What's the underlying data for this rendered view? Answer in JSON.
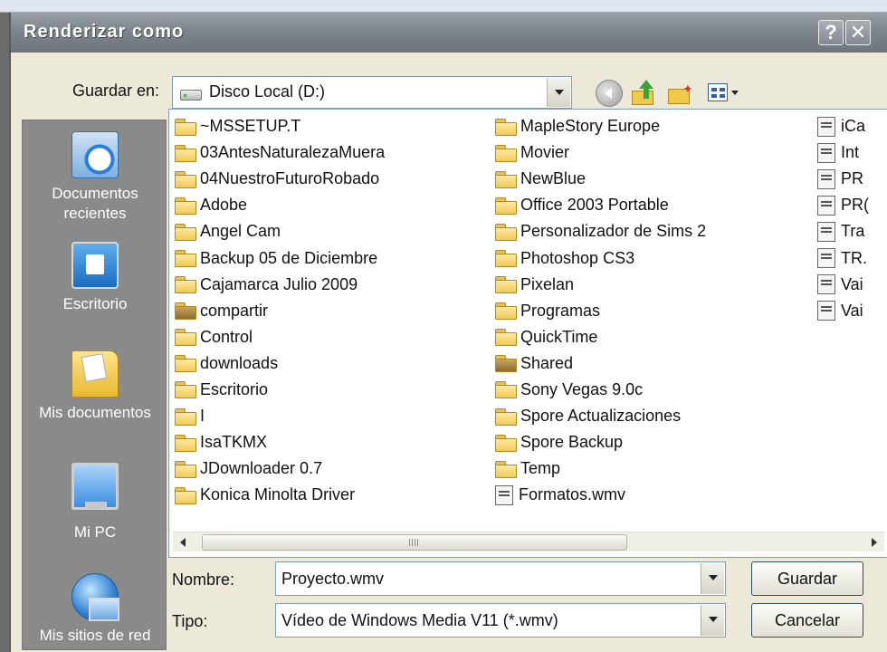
{
  "dialog": {
    "title": "Renderizar como"
  },
  "title_buttons": {
    "help": "?",
    "close": "✕"
  },
  "save_in": {
    "label": "Guardar en:",
    "value": "Disco Local (D:)"
  },
  "toolbar_icons": [
    "back-icon",
    "up-folder-icon",
    "new-folder-icon",
    "views-menu-icon"
  ],
  "places": [
    {
      "label": "Documentos recientes",
      "icon": "recent-documents-icon"
    },
    {
      "label": "Escritorio",
      "icon": "desktop-icon"
    },
    {
      "label": "Mis documentos",
      "icon": "my-documents-icon"
    },
    {
      "label": "Mi PC",
      "icon": "my-computer-icon"
    },
    {
      "label": "Mis sitios de red",
      "icon": "network-places-icon"
    }
  ],
  "files": {
    "column1": [
      {
        "name": "~MSSETUP.T",
        "type": "folder"
      },
      {
        "name": "03AntesNaturalezaMuera",
        "type": "folder"
      },
      {
        "name": "04NuestroFuturoRobado",
        "type": "folder"
      },
      {
        "name": "Adobe",
        "type": "folder"
      },
      {
        "name": "Angel Cam",
        "type": "folder"
      },
      {
        "name": "Backup 05 de Diciembre",
        "type": "folder"
      },
      {
        "name": "Cajamarca Julio 2009",
        "type": "folder"
      },
      {
        "name": "compartir",
        "type": "shared-folder"
      },
      {
        "name": "Control",
        "type": "folder"
      },
      {
        "name": "downloads",
        "type": "folder"
      },
      {
        "name": "Escritorio",
        "type": "folder"
      },
      {
        "name": "I",
        "type": "folder"
      },
      {
        "name": "IsaTKMX",
        "type": "folder"
      },
      {
        "name": "JDownloader 0.7",
        "type": "folder"
      },
      {
        "name": "Konica Minolta Driver",
        "type": "folder"
      }
    ],
    "column2": [
      {
        "name": "MapleStory Europe",
        "type": "folder"
      },
      {
        "name": "Movier",
        "type": "folder"
      },
      {
        "name": "NewBlue",
        "type": "folder"
      },
      {
        "name": "Office 2003 Portable",
        "type": "folder"
      },
      {
        "name": "Personalizador de Sims 2",
        "type": "folder"
      },
      {
        "name": "Photoshop CS3",
        "type": "folder"
      },
      {
        "name": "Pixelan",
        "type": "folder"
      },
      {
        "name": "Programas",
        "type": "folder"
      },
      {
        "name": "QuickTime",
        "type": "folder"
      },
      {
        "name": "Shared",
        "type": "shared-folder"
      },
      {
        "name": "Sony Vegas 9.0c",
        "type": "folder"
      },
      {
        "name": "Spore Actualizaciones",
        "type": "folder"
      },
      {
        "name": "Spore Backup",
        "type": "folder"
      },
      {
        "name": "Temp",
        "type": "folder"
      },
      {
        "name": "Formatos.wmv",
        "type": "file"
      }
    ],
    "column3": [
      {
        "name": "iCa",
        "type": "file"
      },
      {
        "name": "Int",
        "type": "file"
      },
      {
        "name": "PR",
        "type": "file"
      },
      {
        "name": "PR(",
        "type": "file"
      },
      {
        "name": "Tra",
        "type": "file"
      },
      {
        "name": "TR.",
        "type": "file"
      },
      {
        "name": "Vai",
        "type": "file"
      },
      {
        "name": "Vai",
        "type": "file"
      }
    ]
  },
  "filename": {
    "label": "Nombre:",
    "value": "Proyecto.wmv"
  },
  "filetype": {
    "label": "Tipo:",
    "value": "Vídeo de Windows Media V11 (*.wmv)"
  },
  "buttons": {
    "save": "Guardar",
    "cancel": "Cancelar"
  },
  "scrollbar": {
    "grip": "III"
  }
}
